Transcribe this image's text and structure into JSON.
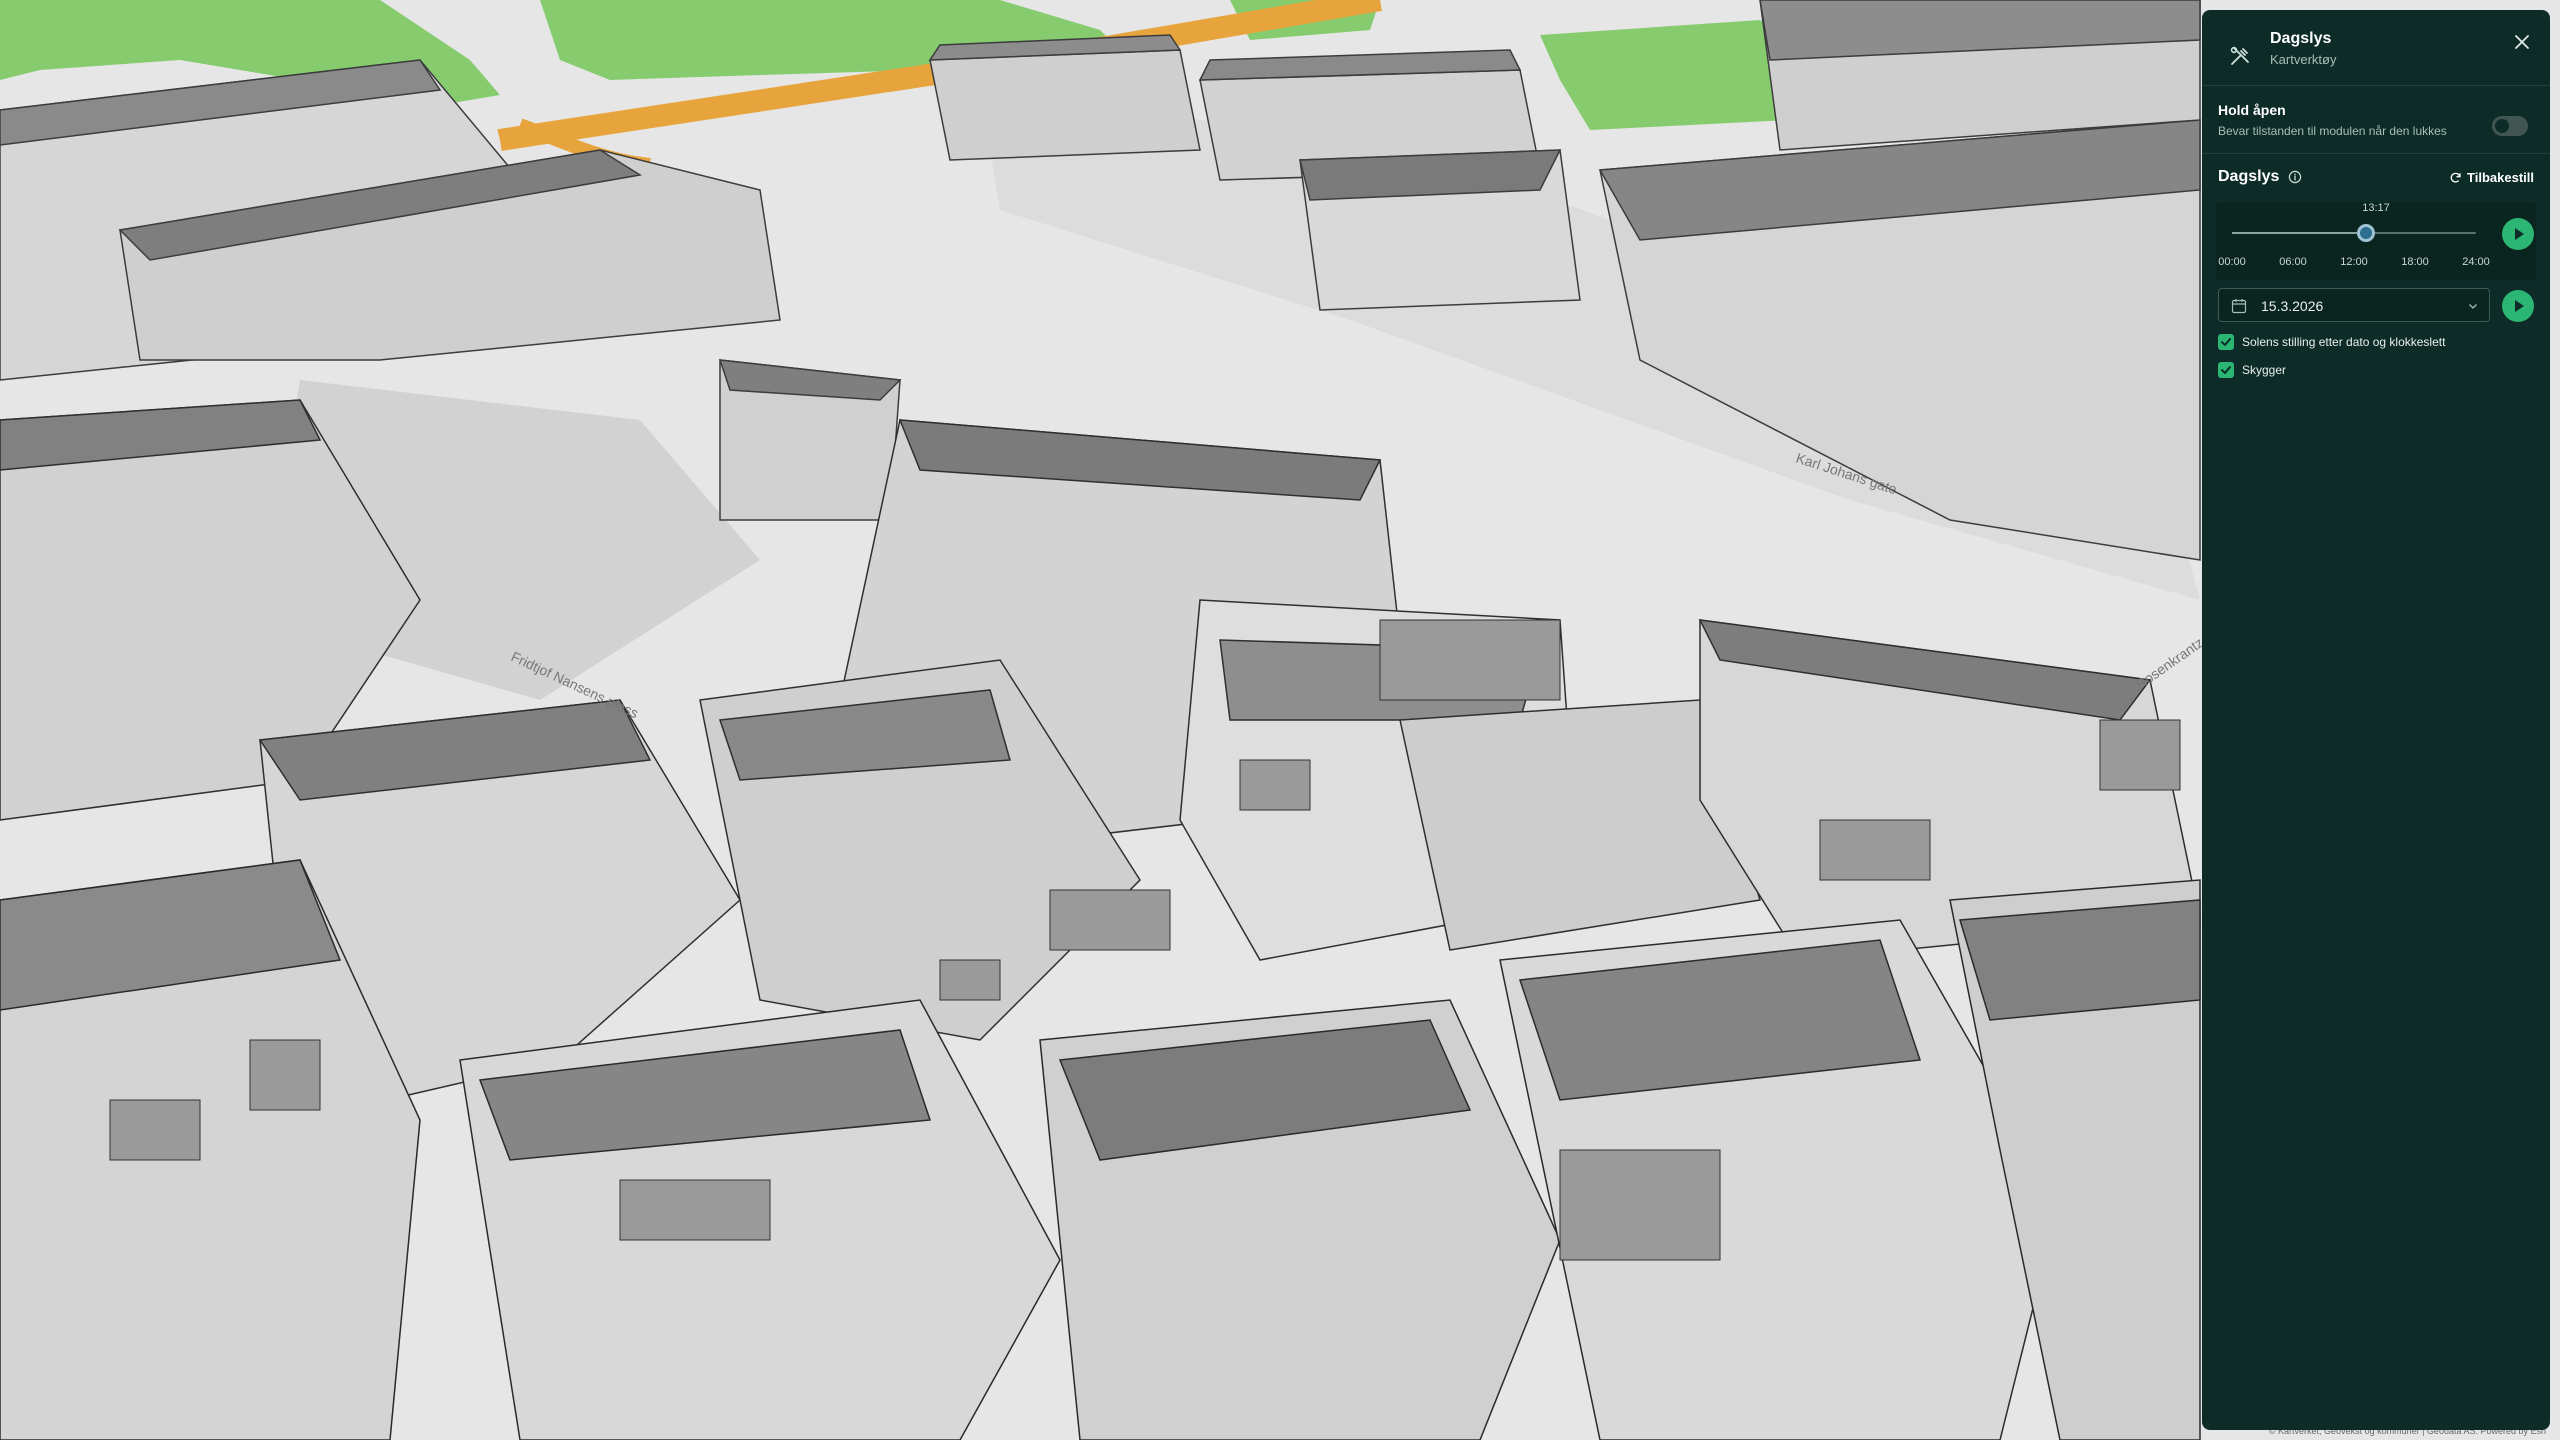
{
  "panel": {
    "title": "Dagslys",
    "subtitle": "Kartverktøy",
    "tool_icon": "tools-icon",
    "close_icon": "close-icon",
    "hold_open": {
      "title": "Hold åpen",
      "description": "Bevar tilstanden til modulen når den lukkes",
      "enabled": false
    },
    "daylight": {
      "title": "Dagslys",
      "reset_label": "Tilbakestill",
      "current_time": "13:17",
      "time_value_fraction": 0.551,
      "time_labels": [
        "00:00",
        "06:00",
        "12:00",
        "18:00",
        "24:00"
      ],
      "date": "15.3.2026",
      "options": [
        {
          "label": "Solens stilling etter dato og klokkeslett",
          "checked": true
        },
        {
          "label": "Skygger",
          "checked": true
        }
      ]
    }
  },
  "map": {
    "street_labels": [
      "Karl Johans gate",
      "Fridtjof Nansens plass",
      "Rosenkrantz"
    ],
    "colors": {
      "park": "#86cc6e",
      "road_orange": "#e8a43c",
      "ground": "#e9e9e9",
      "roof": "#878787",
      "wall_light": "#d9d9d9",
      "wall_dark": "#b7b7b7"
    }
  },
  "attribution": "© Kartverket, Geovekst og kommuner | Geodata AS. Powered by Esri"
}
